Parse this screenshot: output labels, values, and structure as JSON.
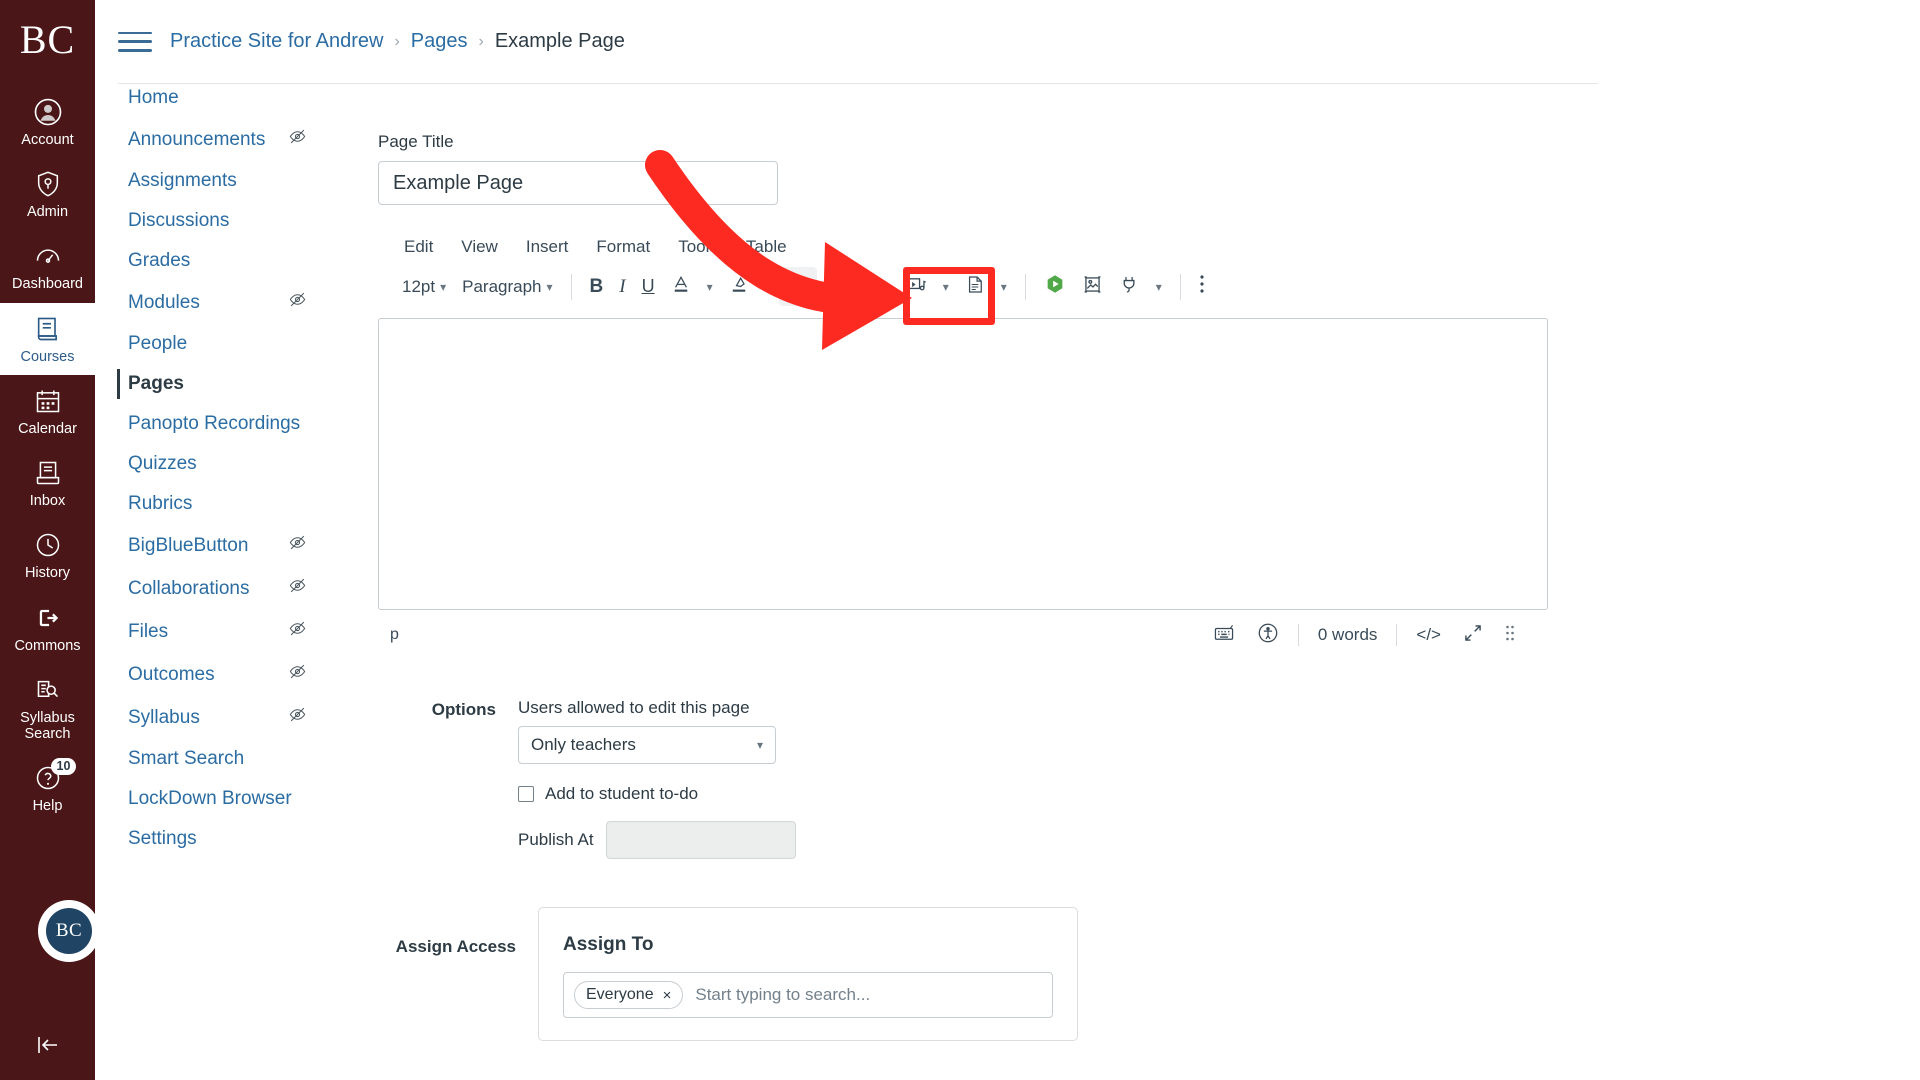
{
  "global_nav": {
    "logo": "BC",
    "items": [
      {
        "label": "Account",
        "icon": "account-icon",
        "active": false
      },
      {
        "label": "Admin",
        "icon": "admin-shield-icon",
        "active": false
      },
      {
        "label": "Dashboard",
        "icon": "dashboard-gauge-icon",
        "active": false
      },
      {
        "label": "Courses",
        "icon": "courses-book-icon",
        "active": true
      },
      {
        "label": "Calendar",
        "icon": "calendar-icon",
        "active": false
      },
      {
        "label": "Inbox",
        "icon": "inbox-icon",
        "active": false
      },
      {
        "label": "History",
        "icon": "history-clock-icon",
        "active": false
      },
      {
        "label": "Commons",
        "icon": "commons-arrow-icon",
        "active": false
      },
      {
        "label": "Syllabus Search",
        "icon": "syllabus-search-icon",
        "active": false
      },
      {
        "label": "Help",
        "icon": "help-question-icon",
        "active": false,
        "badge": "10"
      }
    ],
    "avatar_initials": "BC",
    "collapse_label": "Collapse navigation"
  },
  "course_nav": {
    "items": [
      {
        "label": "Home",
        "hidden": false,
        "active": false
      },
      {
        "label": "Announcements",
        "hidden": true,
        "active": false
      },
      {
        "label": "Assignments",
        "hidden": false,
        "active": false
      },
      {
        "label": "Discussions",
        "hidden": false,
        "active": false
      },
      {
        "label": "Grades",
        "hidden": false,
        "active": false
      },
      {
        "label": "Modules",
        "hidden": true,
        "active": false
      },
      {
        "label": "People",
        "hidden": false,
        "active": false
      },
      {
        "label": "Pages",
        "hidden": false,
        "active": true
      },
      {
        "label": "Panopto Recordings",
        "hidden": false,
        "active": false
      },
      {
        "label": "Quizzes",
        "hidden": false,
        "active": false
      },
      {
        "label": "Rubrics",
        "hidden": false,
        "active": false
      },
      {
        "label": "BigBlueButton",
        "hidden": true,
        "active": false
      },
      {
        "label": "Collaborations",
        "hidden": true,
        "active": false
      },
      {
        "label": "Files",
        "hidden": true,
        "active": false
      },
      {
        "label": "Outcomes",
        "hidden": true,
        "active": false
      },
      {
        "label": "Syllabus",
        "hidden": true,
        "active": false
      },
      {
        "label": "Smart Search",
        "hidden": false,
        "active": false
      },
      {
        "label": "LockDown Browser",
        "hidden": false,
        "active": false
      },
      {
        "label": "Settings",
        "hidden": false,
        "active": false
      }
    ]
  },
  "breadcrumb": {
    "items": [
      {
        "label": "Practice Site for Andrew",
        "current": false
      },
      {
        "label": "Pages",
        "current": false
      },
      {
        "label": "Example Page",
        "current": true
      }
    ],
    "separator": "›"
  },
  "editor": {
    "page_title_label": "Page Title",
    "page_title_value": "Example Page",
    "menubar": [
      "Edit",
      "View",
      "Insert",
      "Format",
      "Tools",
      "Table"
    ],
    "toolbar": {
      "font_size": "12pt",
      "block_format": "Paragraph",
      "bold": "B",
      "italic": "I",
      "underline": "U",
      "text_color_icon": "text-color-icon",
      "highlight_color_icon": "highlight-color-icon",
      "link_icon": "link-icon",
      "image_icon": "image-icon",
      "media_icon": "media-icon",
      "document_icon": "document-icon",
      "panopto_icon": "panopto-icon",
      "media_library_icon": "media-library-icon",
      "apps_icon": "apps-plug-icon",
      "more_icon": "more-options-icon"
    },
    "status": {
      "element_path": "p",
      "word_count": "0 words",
      "keyboard_icon": "keyboard-shortcuts-icon",
      "a11y_icon": "accessibility-checker-icon",
      "html_editor_icon": "</>",
      "fullscreen_icon": "fullscreen-icon",
      "resize_icon": "resize-handle-icon"
    }
  },
  "options": {
    "section_label": "Options",
    "edit_roles_label": "Users allowed to edit this page",
    "edit_roles_value": "Only teachers",
    "todo_checkbox_label": "Add to student to-do",
    "todo_checked": false,
    "publish_at_label": "Publish At",
    "publish_at_value": ""
  },
  "assign_access": {
    "section_label": "Assign Access",
    "card_title": "Assign To",
    "pills": [
      {
        "label": "Everyone",
        "remove": "×"
      }
    ],
    "placeholder": "Start typing to search..."
  },
  "annotation": {
    "arrow_color": "#fc2a21",
    "highlight_color": "#fc2a21",
    "target": "link-icon"
  }
}
